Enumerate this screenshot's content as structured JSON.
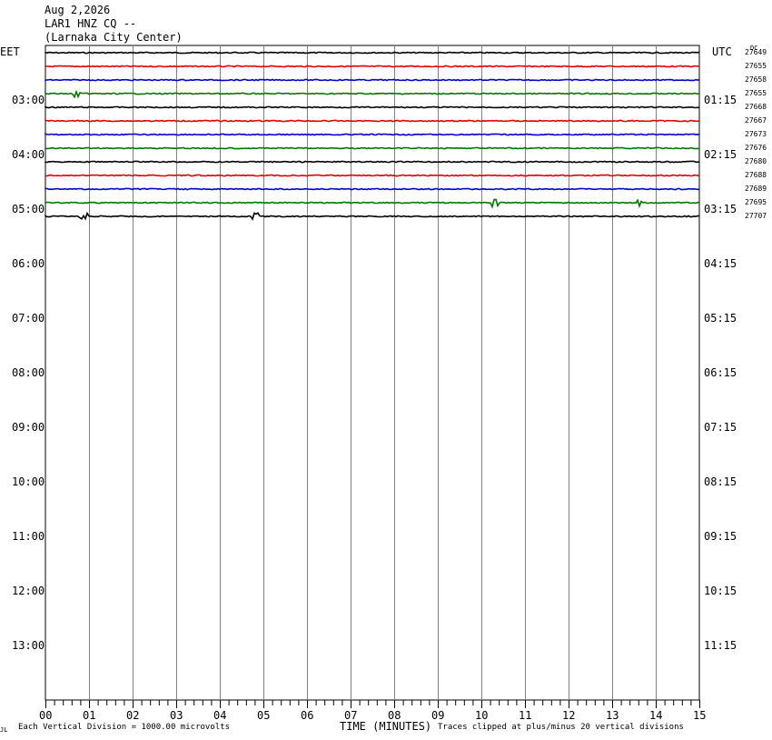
{
  "header": {
    "date": "Aug 2,2026",
    "station": "LAR1 HNZ CQ --",
    "location": "(Larnaka City Center)"
  },
  "left_tz": "EET",
  "right_tz": "UTC",
  "dc_label": "DC",
  "trace_colors": [
    "#000000",
    "#e00000",
    "#0000c8",
    "#007800"
  ],
  "chart_data": {
    "type": "line",
    "xlabel": "TIME (MINUTES)",
    "xlim": [
      0,
      15
    ],
    "x_ticks": [
      "00",
      "01",
      "02",
      "03",
      "04",
      "05",
      "06",
      "07",
      "08",
      "09",
      "10",
      "11",
      "12",
      "13",
      "14",
      "15"
    ],
    "rows_per_hour": 4,
    "left_hour_labels": [
      "03:00",
      "04:00",
      "05:00",
      "06:00",
      "07:00",
      "08:00",
      "09:00",
      "10:00",
      "11:00",
      "12:00",
      "13:00"
    ],
    "right_hour_labels": [
      "01:15",
      "02:15",
      "03:15",
      "04:15",
      "05:15",
      "06:15",
      "07:15",
      "08:15",
      "09:15",
      "10:15",
      "11:15"
    ],
    "traces": [
      {
        "dc": "27649",
        "color": "#000000"
      },
      {
        "dc": "27655",
        "color": "#e00000"
      },
      {
        "dc": "27658",
        "color": "#0000c8"
      },
      {
        "dc": "27655",
        "color": "#007800"
      },
      {
        "dc": "27668",
        "color": "#000000"
      },
      {
        "dc": "27667",
        "color": "#e00000"
      },
      {
        "dc": "27673",
        "color": "#0000c8"
      },
      {
        "dc": "27676",
        "color": "#007800"
      },
      {
        "dc": "27680",
        "color": "#000000"
      },
      {
        "dc": "27688",
        "color": "#e00000"
      },
      {
        "dc": "27689",
        "color": "#0000c8"
      },
      {
        "dc": "27695",
        "color": "#007800"
      },
      {
        "dc": "27707",
        "color": "#000000"
      }
    ]
  },
  "footer": {
    "left_mark": "JL",
    "scale_note": "Each Vertical Division = 1000.00 microvolts",
    "clip_note": "Traces clipped at plus/minus 20 vertical divisions"
  }
}
